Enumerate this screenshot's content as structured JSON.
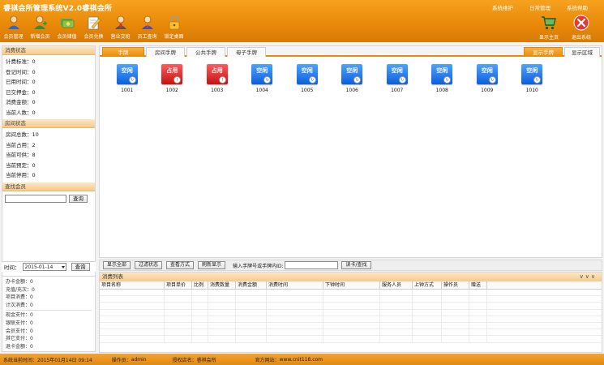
{
  "app": {
    "title": "睿祺会所管理系统V2.0睿祺会所"
  },
  "top_menu": [
    "系统维护",
    "日常管理",
    "系统帮助"
  ],
  "toolbar": [
    {
      "label": "会员管理",
      "icon": "member-icon"
    },
    {
      "label": "新增会员",
      "icon": "add-member-icon"
    },
    {
      "label": "会员储值",
      "icon": "recharge-icon"
    },
    {
      "label": "会员兑换",
      "icon": "exchange-icon"
    },
    {
      "label": "营业交班",
      "icon": "shift-handover-icon"
    },
    {
      "label": "员工查询",
      "icon": "employee-search-icon"
    },
    {
      "label": "锁定桌面",
      "icon": "lock-icon"
    }
  ],
  "right_buttons": [
    {
      "label": "显示主页",
      "icon": "cart-icon"
    },
    {
      "label": "退出系统",
      "icon": "exit-icon"
    }
  ],
  "consumption_status": {
    "title": "消费状态",
    "rows": [
      "计费标准：0",
      "登记时间：0",
      "已用时间：0",
      "已交押金：0",
      "消费金额：0",
      "当前人数：0"
    ]
  },
  "room_status": {
    "title": "房间状态",
    "rows": [
      "房间总数：10",
      "当前占用：2",
      "当前可供：8",
      "当前预定：0",
      "当前停用：0"
    ]
  },
  "member_search": {
    "title": "查找会员",
    "button": "查询"
  },
  "date_filter": {
    "label": "时间：",
    "value": "2015-01-14",
    "button": "查询"
  },
  "summary": {
    "group1": [
      "办卡金额：0",
      "充值/充次：0",
      "项目消费：0",
      "计次消费：0"
    ],
    "group2": [
      "现金支付：0",
      "银联支付：0",
      "会员支付：0",
      "其它支付：0",
      "退卡金额：0"
    ]
  },
  "tabs": {
    "left": [
      "手牌",
      "房间手牌",
      "公共手牌",
      "母子手牌"
    ],
    "right": [
      "显示手牌",
      "显示区域"
    ]
  },
  "rooms": [
    {
      "status": "空闲",
      "number": "1001",
      "state": "free"
    },
    {
      "status": "占用",
      "number": "1002",
      "state": "busy"
    },
    {
      "status": "占用",
      "number": "1003",
      "state": "busy"
    },
    {
      "status": "空闲",
      "number": "1004",
      "state": "free"
    },
    {
      "status": "空闲",
      "number": "1005",
      "state": "free"
    },
    {
      "status": "空闲",
      "number": "1006",
      "state": "free"
    },
    {
      "status": "空闲",
      "number": "1007",
      "state": "free"
    },
    {
      "status": "空闲",
      "number": "1008",
      "state": "free"
    },
    {
      "status": "空闲",
      "number": "1009",
      "state": "free"
    },
    {
      "status": "空闲",
      "number": "1010",
      "state": "free"
    }
  ],
  "function_bar": {
    "buttons": [
      "显示全部",
      "过滤状态",
      "查看方式",
      "刷新显示"
    ],
    "input_label": "输入手牌号或手牌内ID:",
    "search_button": "读卡/查找"
  },
  "consumption_list": {
    "title": "消费列表",
    "collapse": "∨∨∨",
    "columns": [
      "项目名称",
      "项目单价",
      "比例",
      "消费数量",
      "消费金额",
      "消费时间",
      "下钟时间",
      "服务人员",
      "上钟方式",
      "操作员",
      "赠送"
    ]
  },
  "status_bar": {
    "time_label": "系统当前时间：",
    "time_value": "2015年01月14日 09:14",
    "operator_label": "操作员：",
    "operator_value": "admin",
    "store_label": "授权店名：",
    "store_value": "睿祺会所",
    "site_label": "官方网站：",
    "site_value": "www.cnit118.com"
  },
  "colors": {
    "header_orange": "#e98a0a",
    "free_blue": "#0d5fd6",
    "busy_red": "#c11414"
  }
}
